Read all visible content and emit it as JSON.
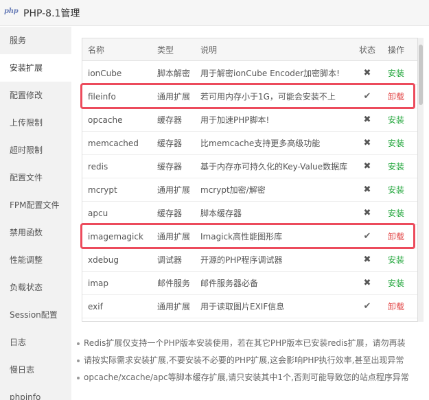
{
  "window": {
    "logo_text": "php",
    "title": "PHP-8.1管理"
  },
  "sidebar": {
    "items": [
      {
        "label": "服务"
      },
      {
        "label": "安装扩展",
        "active": true
      },
      {
        "label": "配置修改"
      },
      {
        "label": "上传限制"
      },
      {
        "label": "超时限制"
      },
      {
        "label": "配置文件"
      },
      {
        "label": "FPM配置文件"
      },
      {
        "label": "禁用函数"
      },
      {
        "label": "性能调整"
      },
      {
        "label": "负载状态"
      },
      {
        "label": "Session配置"
      },
      {
        "label": "日志"
      },
      {
        "label": "慢日志"
      },
      {
        "label": "phpinfo"
      }
    ]
  },
  "table": {
    "headers": {
      "name": "名称",
      "type": "类型",
      "desc": "说明",
      "status": "状态",
      "op": "操作"
    },
    "rows": [
      {
        "name": "ionCube",
        "type": "脚本解密",
        "desc": "用于解密ionCube Encoder加密脚本!",
        "status": "✖",
        "installed": false,
        "op": "安装"
      },
      {
        "name": "fileinfo",
        "type": "通用扩展",
        "desc": "若可用内存小于1G，可能会安装不上",
        "status": "✔",
        "installed": true,
        "op": "卸载",
        "highlighted": true
      },
      {
        "name": "opcache",
        "type": "缓存器",
        "desc": "用于加速PHP脚本!",
        "status": "✖",
        "installed": false,
        "op": "安装"
      },
      {
        "name": "memcached",
        "type": "缓存器",
        "desc": "比memcache支持更多高级功能",
        "status": "✖",
        "installed": false,
        "op": "安装"
      },
      {
        "name": "redis",
        "type": "缓存器",
        "desc": "基于内存亦可持久化的Key-Value数据库",
        "status": "✖",
        "installed": false,
        "op": "安装"
      },
      {
        "name": "mcrypt",
        "type": "通用扩展",
        "desc": "mcrypt加密/解密",
        "status": "✖",
        "installed": false,
        "op": "安装"
      },
      {
        "name": "apcu",
        "type": "缓存器",
        "desc": "脚本缓存器",
        "status": "✖",
        "installed": false,
        "op": "安装"
      },
      {
        "name": "imagemagick",
        "type": "通用扩展",
        "desc": "Imagick高性能图形库",
        "status": "✔",
        "installed": true,
        "op": "卸载",
        "highlighted": true
      },
      {
        "name": "xdebug",
        "type": "调试器",
        "desc": "开源的PHP程序调试器",
        "status": "✖",
        "installed": false,
        "op": "安装"
      },
      {
        "name": "imap",
        "type": "邮件服务",
        "desc": "邮件服务器必备",
        "status": "✖",
        "installed": false,
        "op": "安装"
      },
      {
        "name": "exif",
        "type": "通用扩展",
        "desc": "用于读取图片EXIF信息",
        "status": "✔",
        "installed": true,
        "op": "卸载"
      }
    ]
  },
  "notes": [
    "Redis扩展仅支持一个PHP版本安装使用，若在其它PHP版本已安装redis扩展，请勿再装",
    "请按实际需求安装扩展,不要安装不必要的PHP扩展,这会影响PHP执行效率,甚至出现异常",
    "opcache/xcache/apc等脚本缓存扩展,请只安装其中1个,否则可能导致您的站点程序异常"
  ],
  "colors": {
    "install": "#20a53a",
    "uninstall": "#e04040",
    "highlight": "#ec4b5c"
  }
}
